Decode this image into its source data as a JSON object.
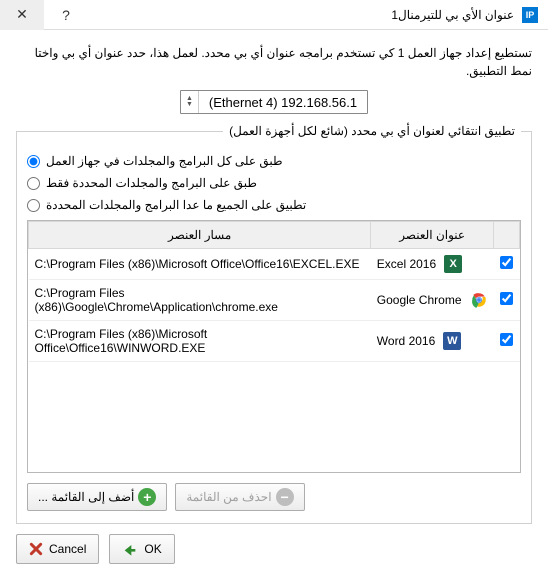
{
  "window": {
    "title": "عنوان الأي بي للتيرمنال1",
    "help_symbol": "?",
    "close_symbol": "✕"
  },
  "instruction": "تستطيع إعداد جهاز العمل 1 كي تستخدم برامجه عنوان أي بي محدد. لعمل هذا، حدد عنوان أي بي واختا نمط التطبيق.",
  "ip_combo": {
    "label": "(Ethernet 4) 192.168.56.1"
  },
  "group": {
    "legend": "تطبيق انتقائي لعنوان أي بي محدد (شائع لكل أجهزة العمل)",
    "radios": [
      {
        "id": "r1",
        "label": "طبق على كل البرامج والمجلدات في جهاز العمل",
        "checked": true
      },
      {
        "id": "r2",
        "label": "طبق على البرامج والمجلدات المحددة فقط",
        "checked": false
      },
      {
        "id": "r3",
        "label": "تطبيق على الجميع ما عدا البرامج والمجلدات المحددة",
        "checked": false
      }
    ],
    "table": {
      "headers": {
        "name": "عنوان العنصر",
        "path": "مسار العنصر"
      },
      "rows": [
        {
          "checked": true,
          "icon_letter": "X",
          "icon_color": "#1e7145",
          "name": "Excel 2016",
          "path": "C:\\Program Files (x86)\\Microsoft Office\\Office16\\EXCEL.EXE"
        },
        {
          "checked": true,
          "icon_letter": "",
          "icon_color": "",
          "name": "Google Chrome",
          "path": "C:\\Program Files (x86)\\Google\\Chrome\\Application\\chrome.exe",
          "chrome": true
        },
        {
          "checked": true,
          "icon_letter": "W",
          "icon_color": "#2b579a",
          "name": "Word 2016",
          "path": "C:\\Program Files (x86)\\Microsoft Office\\Office16\\WINWORD.EXE"
        }
      ]
    },
    "buttons": {
      "add": "أضف إلى القائمة ...",
      "delete": "احذف من القائمة"
    }
  },
  "footer": {
    "ok": "OK",
    "cancel": "Cancel"
  }
}
